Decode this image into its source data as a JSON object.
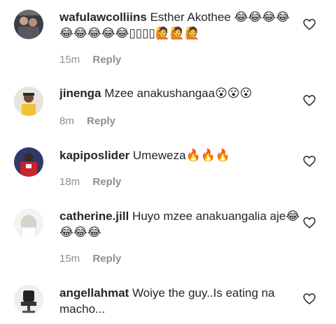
{
  "comments": [
    {
      "username": "wafulawcolliins",
      "text": "Esther Akothee 😂😂😂😂😂😂😂😂😂▯▯▯▯🙋🙋🙋",
      "time": "15m",
      "reply_label": "Reply"
    },
    {
      "username": "jinenga",
      "text": "Mzee anakushangaa😮😮😮",
      "time": "8m",
      "reply_label": "Reply"
    },
    {
      "username": "kapiposlider",
      "text": "Umeweza🔥🔥🔥",
      "time": "18m",
      "reply_label": "Reply"
    },
    {
      "username": "catherine.jill",
      "text": "Huyo mzee anakuangalia aje😂😂😂😂",
      "time": "15m",
      "reply_label": "Reply"
    },
    {
      "username": "angellahmat",
      "text": "Woiye the guy..Is eating na macho...",
      "time": "",
      "reply_label": ""
    }
  ],
  "icons": {
    "like": "heart-outline-icon",
    "avatar": "avatar"
  },
  "colors": {
    "text": "#262626",
    "muted": "#8e8e8e",
    "heart": "#262626"
  }
}
